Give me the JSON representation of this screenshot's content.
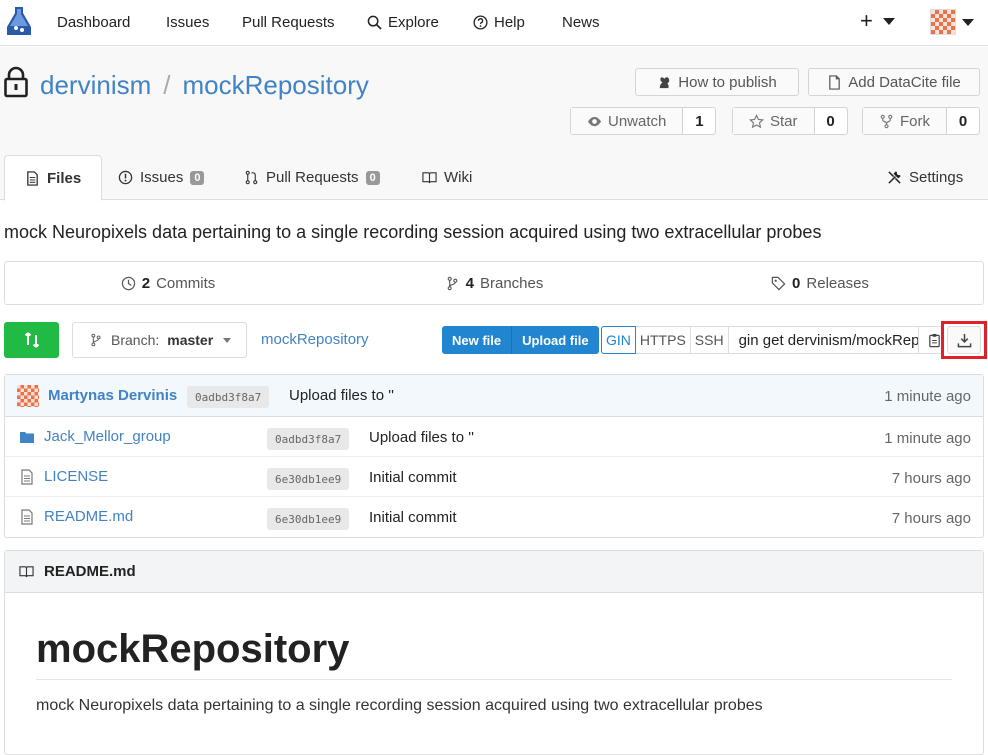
{
  "nav": {
    "items": [
      {
        "label": "Dashboard"
      },
      {
        "label": "Issues"
      },
      {
        "label": "Pull Requests"
      },
      {
        "label": "Explore",
        "icon": "search-icon"
      },
      {
        "label": "Help",
        "icon": "help-icon"
      },
      {
        "label": "News"
      }
    ],
    "plus": "+"
  },
  "repo": {
    "owner": "dervinism",
    "separator": "/",
    "name": "mockRepository",
    "how_to_publish": "How to publish",
    "add_datacite": "Add DataCite file",
    "unwatch_label": "Unwatch",
    "unwatch_count": "1",
    "star_label": "Star",
    "star_count": "0",
    "fork_label": "Fork",
    "fork_count": "0"
  },
  "tabs": {
    "files": "Files",
    "issues": "Issues",
    "issues_count": "0",
    "pulls": "Pull Requests",
    "pulls_count": "0",
    "wiki": "Wiki",
    "settings": "Settings"
  },
  "description": "mock Neuropixels data pertaining to a single recording session acquired using two extracellular probes",
  "stats": {
    "commits_count": "2",
    "commits_label": "Commits",
    "branches_count": "4",
    "branches_label": "Branches",
    "releases_count": "0",
    "releases_label": "Releases"
  },
  "toolbar": {
    "branch_prefix": "Branch:",
    "branch": "master",
    "crumb": "mockRepository",
    "new_file": "New file",
    "upload_file": "Upload file",
    "proto_gin": "GIN",
    "proto_https": "HTTPS",
    "proto_ssh": "SSH",
    "clone_url": "gin get dervinism/mockRepository"
  },
  "latest_commit": {
    "author": "Martynas Dervinis",
    "sha": "0adbd3f8a7",
    "message": "Upload files to ''",
    "age": "1 minute ago"
  },
  "files": [
    {
      "name": "Jack_Mellor_group",
      "type": "folder",
      "sha": "0adbd3f8a7",
      "message": "Upload files to ''",
      "age": "1 minute ago"
    },
    {
      "name": "LICENSE",
      "type": "file",
      "sha": "6e30db1ee9",
      "message": "Initial commit",
      "age": "7 hours ago"
    },
    {
      "name": "README.md",
      "type": "file",
      "sha": "6e30db1ee9",
      "message": "Initial commit",
      "age": "7 hours ago"
    }
  ],
  "readme": {
    "filename": "README.md",
    "heading": "mockRepository",
    "body": "mock Neuropixels data pertaining to a single recording session acquired using two extracellular probes"
  },
  "colors": {
    "link": "#4183c4",
    "primary": "#2185d0",
    "success": "#21ba45",
    "highlight": "#e0202a"
  }
}
